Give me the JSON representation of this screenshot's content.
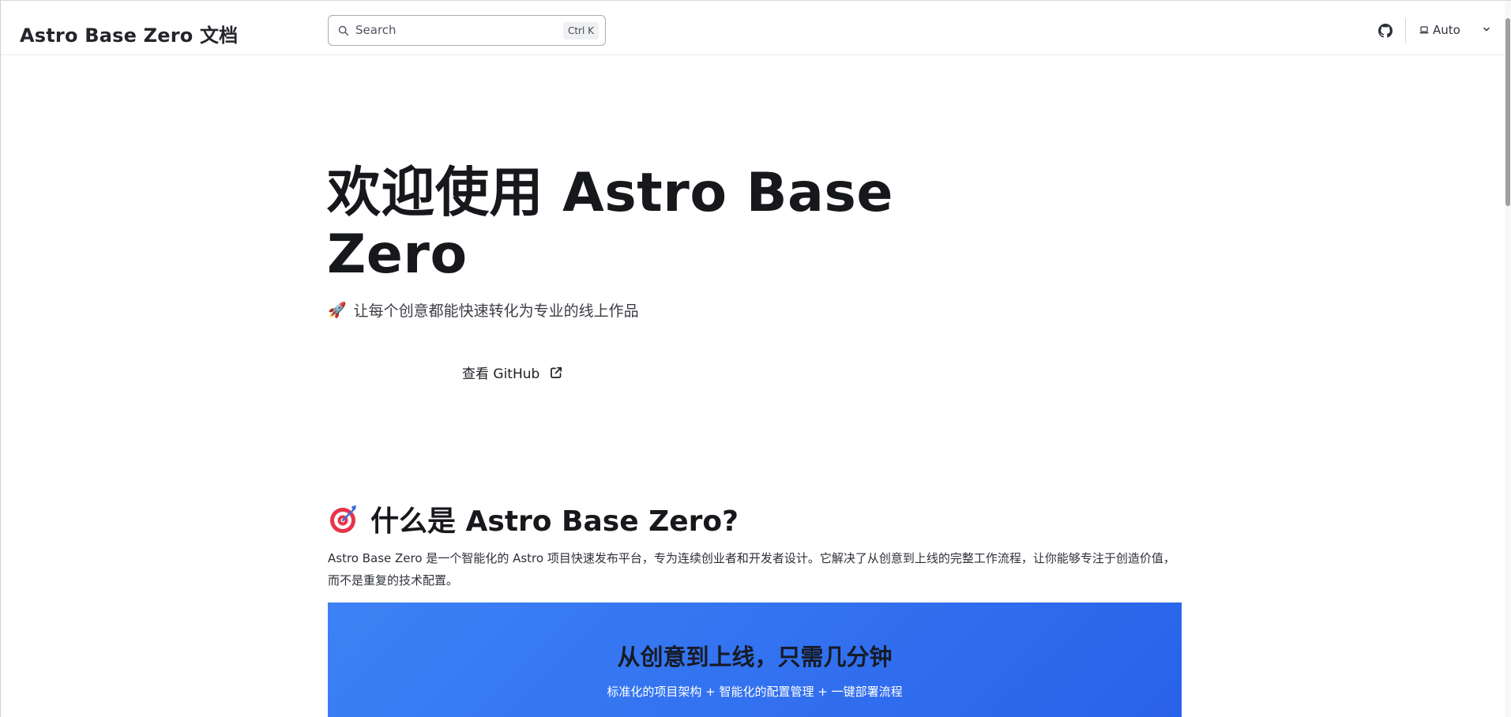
{
  "header": {
    "site_title": "Astro Base Zero 文档",
    "search_placeholder": "Search",
    "search_shortcut": "Ctrl K",
    "theme_label": "Auto"
  },
  "hero": {
    "title": "欢迎使用 Astro Base Zero",
    "tagline_emoji": "🚀",
    "tagline": "让每个创意都能快速转化为专业的线上作品",
    "github_link": "查看 GitHub"
  },
  "section": {
    "emoji": "🎯",
    "title": "什么是 Astro Base Zero?",
    "paragraph": "Astro Base Zero 是一个智能化的 Astro 项目快速发布平台，专为连续创业者和开发者设计。它解决了从创意到上线的完整工作流程，让你能够专注于创造价值，而不是重复的技术配置。",
    "banner_title": "从创意到上线，只需几分钟",
    "banner_subtitle": "标准化的项目架构 + 智能化的配置管理 + 一键部署流程"
  },
  "icons": {
    "search": "search-icon",
    "github": "github-icon",
    "theme": "laptop-icon",
    "chevron": "chevron-down-icon",
    "external": "external-link-icon"
  },
  "colors": {
    "banner_start": "#3d82f5",
    "banner_end": "#2962ea",
    "text": "#17181c"
  }
}
